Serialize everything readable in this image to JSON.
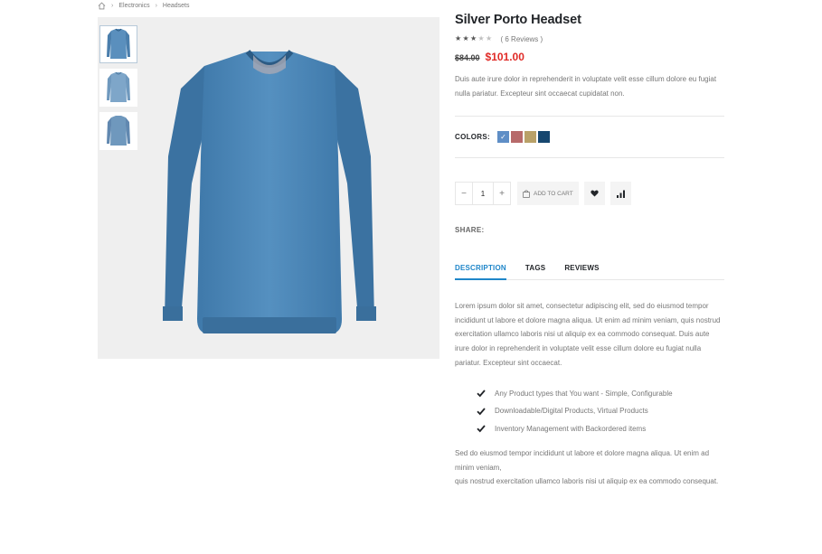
{
  "breadcrumb": {
    "home_icon": "home-icon",
    "items": [
      "Electronics",
      "Headsets"
    ]
  },
  "gallery": {
    "thumbnails": [
      "sweater-front",
      "sweater-side",
      "sweater-back"
    ],
    "selected_index": 0,
    "main_image": "blue-sweater"
  },
  "product": {
    "title": "Silver Porto Headset",
    "rating": 3,
    "rating_max": 5,
    "reviews_text": "( 6 Reviews )",
    "old_price": "$84.00",
    "price": "$101.00",
    "short_description": "Duis aute irure dolor in reprehenderit in voluptate velit esse cillum dolore eu fugiat nulla pariatur. Excepteur sint occaecat cupidatat non."
  },
  "colors": {
    "label": "COLORS:",
    "swatches": [
      "#5f8ec6",
      "#b76a6a",
      "#b9a168",
      "#17476f"
    ],
    "selected_index": 0
  },
  "cart": {
    "minus": "−",
    "quantity": "1",
    "plus": "+",
    "add_to_cart": "ADD TO CART"
  },
  "share_label": "SHARE:",
  "tabs": [
    "DESCRIPTION",
    "TAGS",
    "REVIEWS"
  ],
  "active_tab": 0,
  "description": {
    "paragraph1": "Lorem ipsum dolor sit amet, consectetur adipiscing elit, sed do eiusmod tempor incididunt ut labore et dolore magna aliqua. Ut enim ad minim veniam, quis nostrud exercitation ullamco laboris nisi ut aliquip ex ea commodo consequat. Duis aute irure dolor in reprehenderit in voluptate velit esse cillum dolore eu fugiat nulla pariatur. Excepteur sint occaecat.",
    "features": [
      "Any Product types that You want - Simple, Configurable",
      "Downloadable/Digital Products, Virtual Products",
      "Inventory Management with Backordered items"
    ],
    "paragraph2": "Sed do eiusmod tempor incididunt ut labore et dolore magna aliqua. Ut enim ad minim veniam,",
    "paragraph3": "quis nostrud exercitation ullamco laboris nisi ut aliquip ex ea commodo consequat."
  }
}
